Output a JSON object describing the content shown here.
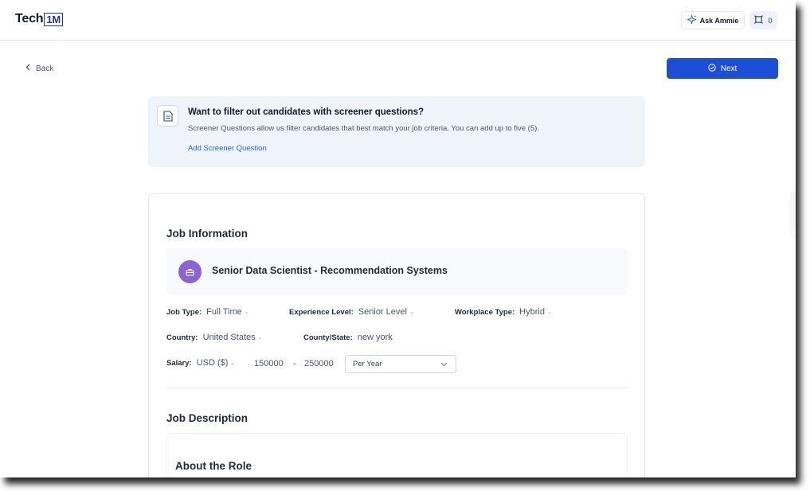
{
  "header": {
    "logo_text": "Tech",
    "logo_box_text": "1M",
    "ask_label": "Ask Ammie",
    "notification_count": "0"
  },
  "nav": {
    "back_label": "Back",
    "next_label": "Next"
  },
  "screener": {
    "title": "Want to filter out candidates with screener questions?",
    "description": "Screener Questions allow us filter candidates that best match your job criteria. You can add up to five (5).",
    "link_label": "Add Screener Question"
  },
  "job_info": {
    "section_title": "Job Information",
    "job_title": "Senior Data Scientist - Recommendation Systems",
    "job_type": {
      "label": "Job Type:",
      "value": "Full Time"
    },
    "experience": {
      "label": "Experience Level:",
      "value": "Senior Level"
    },
    "workplace": {
      "label": "Workplace Type:",
      "value": "Hybrid"
    },
    "country": {
      "label": "Country:",
      "value": "United States"
    },
    "state": {
      "label": "County/State:",
      "value": "new york"
    },
    "salary": {
      "label": "Salary:",
      "currency": "USD ($)",
      "min": "150000",
      "separator": "-",
      "max": "250000",
      "period": "Per Year"
    }
  },
  "job_description": {
    "section_title": "Job Description",
    "subheading": "About the Role"
  },
  "colors": {
    "primary": "#1d4ed8",
    "link": "#2563eb",
    "banner_bg": "#eff4fb",
    "avatar": "#8b64d2"
  }
}
